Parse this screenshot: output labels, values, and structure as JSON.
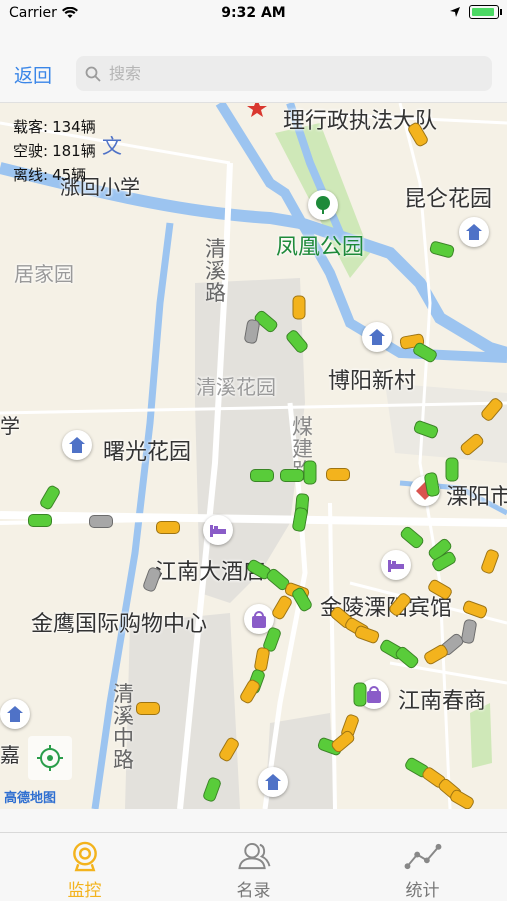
{
  "status_bar": {
    "carrier": "Carrier",
    "time": "9:32 AM"
  },
  "nav": {
    "back_label": "返回",
    "search_placeholder": "搜索"
  },
  "stats": {
    "carrying": {
      "label": "载客:",
      "value": "134辆"
    },
    "empty": {
      "label": "空驶:",
      "value": "181辆"
    },
    "offline": {
      "label": "离线:",
      "value": "45辆"
    }
  },
  "map": {
    "logo": "高德地图",
    "pois": {
      "p1": "理行政执法大队",
      "p2": "凤凰公园",
      "p3": "昆仑花园",
      "p4": "居家园",
      "p5": "博阳新村",
      "p6": "清溪花园",
      "p7": "曙光花园",
      "p8": "溧阳市",
      "p9": "江南大酒店",
      "p10": "金陵溧阳宾馆",
      "p11": "金鹰国际购物中心",
      "p12": "江南春商",
      "p13": "涨回小学",
      "p14": "学",
      "p15": "嘉"
    },
    "roads": {
      "r1": "清溪路",
      "r2": "清溪中路",
      "r3": "煤建路"
    }
  },
  "tabs": [
    {
      "label": "监控",
      "icon": "camera-icon",
      "active": true
    },
    {
      "label": "名录",
      "icon": "contacts-icon",
      "active": false
    },
    {
      "label": "统计",
      "icon": "chart-line-icon",
      "active": false
    }
  ],
  "colors": {
    "accent": "#f3b31d",
    "link": "#3a86e8",
    "occupied_car": "#f3b31d",
    "empty_car": "#59cc3a",
    "offline_car": "#a7a7a7"
  }
}
